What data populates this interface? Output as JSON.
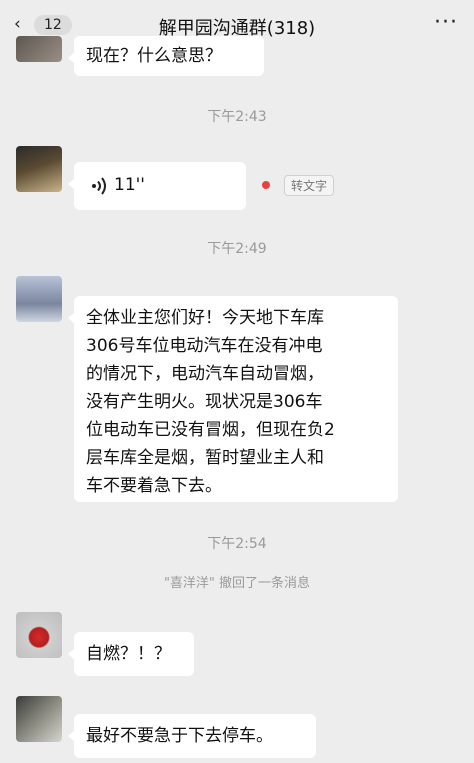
{
  "header": {
    "back_label": "‹",
    "unread_count": "12",
    "title": "解甲园沟通群(318)",
    "more_label": "···"
  },
  "messages": [
    {
      "type": "text",
      "text": "现在？什么意思？"
    },
    {
      "type": "time",
      "text": "下午2:43"
    },
    {
      "type": "voice",
      "duration": "11''",
      "convert_label": "转文字"
    },
    {
      "type": "time",
      "text": "下午2:49"
    },
    {
      "type": "text",
      "lines": [
        "全体业主您们好！今天地下车库",
        "306号车位电动汽车在没有冲电",
        "的情况下，电动汽车自动冒烟，",
        "没有产生明火。现状况是306车",
        "位电动车已没有冒烟，但现在负2",
        "层车库全是烟，暂时望业主人和",
        "车不要着急下去。"
      ]
    },
    {
      "type": "time",
      "text": "下午2:54"
    },
    {
      "type": "system",
      "text": "\"喜洋洋\" 撤回了一条消息"
    },
    {
      "type": "text",
      "text": "自燃？！？"
    },
    {
      "type": "text",
      "text": "最好不要急于下去停车。"
    }
  ],
  "colors": {
    "background": "#ededed",
    "bubble": "#ffffff",
    "unread_dot": "#e64340"
  }
}
